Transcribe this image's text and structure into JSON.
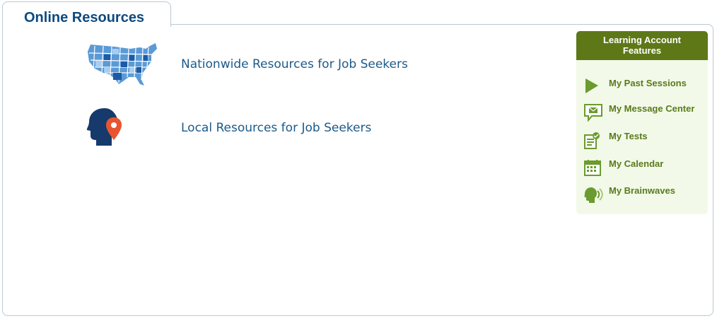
{
  "tab": {
    "title": "Online Resources"
  },
  "resources": [
    {
      "label": "Nationwide Resources for Job Seekers",
      "icon": "us-map-icon"
    },
    {
      "label": "Local Resources for Job Seekers",
      "icon": "head-location-icon"
    }
  ],
  "features": {
    "header_line1": "Learning Account",
    "header_line2": "Features",
    "items": [
      {
        "label": "My Past Sessions",
        "icon": "play-arrow-icon"
      },
      {
        "label": "My Message Center",
        "icon": "message-icon"
      },
      {
        "label": "My Tests",
        "icon": "test-document-icon"
      },
      {
        "label": "My Calendar",
        "icon": "calendar-icon"
      },
      {
        "label": "My Brainwaves",
        "icon": "brainwaves-icon"
      }
    ]
  },
  "colors": {
    "tab_title": "#0d4a80",
    "resource_link": "#1c5a8a",
    "features_header_bg": "#5e7818",
    "features_bg": "#f2f9e8",
    "features_text": "#5a7a1c",
    "icon_green": "#6a9b2e"
  }
}
